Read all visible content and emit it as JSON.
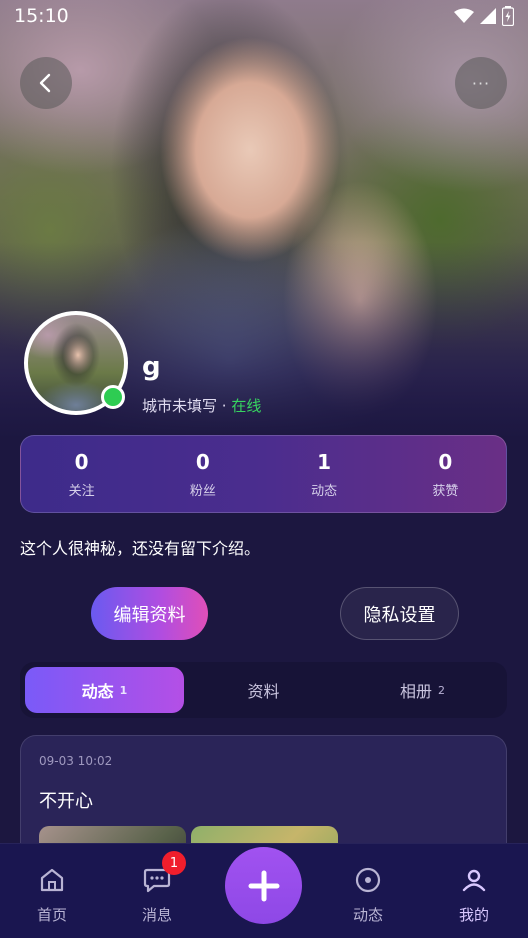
{
  "status_bar": {
    "time": "15:10"
  },
  "profile": {
    "name": "g",
    "city": "城市未填写",
    "separator": " · ",
    "online_status": "在线",
    "bio": "这个人很神秘，还没有留下介绍。"
  },
  "stats": [
    {
      "value": "0",
      "label": "关注"
    },
    {
      "value": "0",
      "label": "粉丝"
    },
    {
      "value": "1",
      "label": "动态"
    },
    {
      "value": "0",
      "label": "获赞"
    }
  ],
  "actions": {
    "edit_label": "编辑资料",
    "privacy_label": "隐私设置"
  },
  "tabs": [
    {
      "label": "动态",
      "count": "1",
      "active": true
    },
    {
      "label": "资料",
      "count": "",
      "active": false
    },
    {
      "label": "相册",
      "count": "2",
      "active": false
    }
  ],
  "post": {
    "time": "09-03 10:02",
    "text": "不开心"
  },
  "bottom_nav": {
    "home_label": "首页",
    "messages_label": "消息",
    "messages_badge": "1",
    "feed_label": "动态",
    "mine_label": "我的"
  },
  "colors": {
    "background": "#1c1740",
    "accent_purple": "#9a4fee",
    "online_green": "#2ecc52",
    "badge_red": "#f01e2c"
  }
}
